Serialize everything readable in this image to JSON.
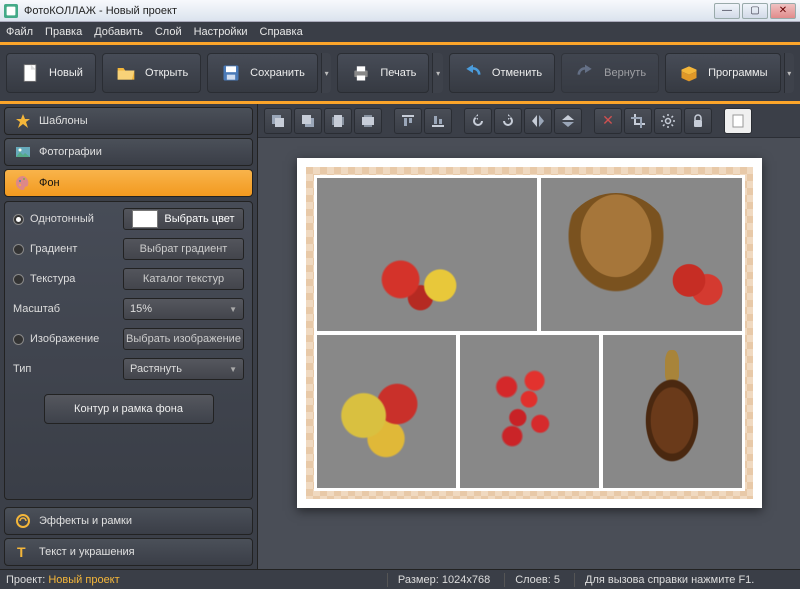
{
  "app_title": "ФотоКОЛЛАЖ - Новый проект",
  "menu": [
    "Файл",
    "Правка",
    "Добавить",
    "Слой",
    "Настройки",
    "Справка"
  ],
  "toolbar": [
    {
      "id": "new",
      "label": "Новый",
      "icon": "file"
    },
    {
      "id": "open",
      "label": "Открыть",
      "icon": "folder"
    },
    {
      "id": "save",
      "label": "Сохранить",
      "icon": "disk",
      "dd": true
    },
    {
      "id": "print",
      "label": "Печать",
      "icon": "printer",
      "dd": true
    },
    {
      "id": "undo",
      "label": "Отменить",
      "icon": "undo"
    },
    {
      "id": "redo",
      "label": "Вернуть",
      "icon": "redo",
      "dim": true
    },
    {
      "id": "programs",
      "label": "Программы",
      "icon": "box",
      "dd": true
    }
  ],
  "side_tabs": [
    {
      "id": "templates",
      "label": "Шаблоны",
      "icon": "star"
    },
    {
      "id": "photos",
      "label": "Фотографии",
      "icon": "photo"
    },
    {
      "id": "bg",
      "label": "Фон",
      "icon": "palette",
      "active": true
    },
    {
      "id": "effects",
      "label": "Эффекты и рамки",
      "icon": "fx",
      "bottom": true
    },
    {
      "id": "text",
      "label": "Текст и украшения",
      "icon": "text",
      "bottom": true
    }
  ],
  "bg_panel": {
    "solid_label": "Однотонный",
    "pick_color": "Выбрать цвет",
    "gradient_label": "Градиент",
    "pick_gradient": "Выбрат градиент",
    "texture_label": "Текстура",
    "texture_catalog": "Каталог текстур",
    "scale_label": "Масштаб",
    "scale_value": "15%",
    "image_label": "Изображение",
    "pick_image": "Выбрать изображение",
    "type_label": "Тип",
    "type_value": "Растянуть",
    "outline_btn": "Контур и рамка фона",
    "selected": "solid"
  },
  "canvas_toolbar_icons": [
    "layer-down",
    "layer-up",
    "layer-front",
    "layer-back",
    "align-left",
    "align-center",
    "align-right",
    "flip-h",
    "flip-v",
    "delete",
    "crop",
    "gear",
    "lock",
    "new-page"
  ],
  "status": {
    "project_label": "Проект:",
    "project_value": "Новый проект",
    "size_label": "Размер:",
    "size_value": "1024x768",
    "layers_label": "Слоев:",
    "layers_value": "5",
    "help": "Для вызова справки нажмите F1."
  }
}
